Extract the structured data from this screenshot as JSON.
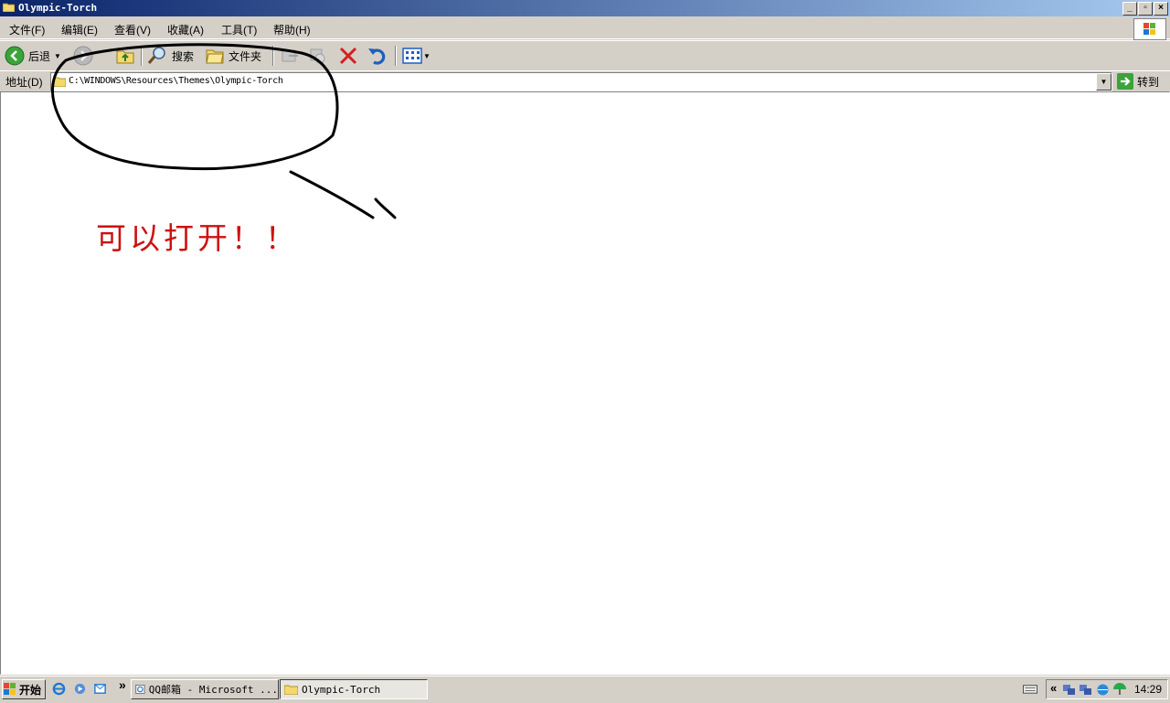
{
  "window": {
    "title": "Olympic-Torch"
  },
  "menu": [
    "文件(F)",
    "编辑(E)",
    "查看(V)",
    "收藏(A)",
    "工具(T)",
    "帮助(H)"
  ],
  "toolbar": {
    "back": "后退",
    "search": "搜索",
    "folders": "文件夹"
  },
  "address": {
    "label": "地址(D)",
    "path": "C:\\WINDOWS\\Resources\\Themes\\Olympic-Torch",
    "go": "转到"
  },
  "annotation": {
    "text": "可以打开！！",
    "color": "#cc1111"
  },
  "taskbar": {
    "start": "开始",
    "tasks": [
      "QQ邮箱 - Microsoft ...",
      "Olympic-Torch"
    ],
    "chevron": "»",
    "tray_chevron": "«",
    "clock": "14:29"
  }
}
